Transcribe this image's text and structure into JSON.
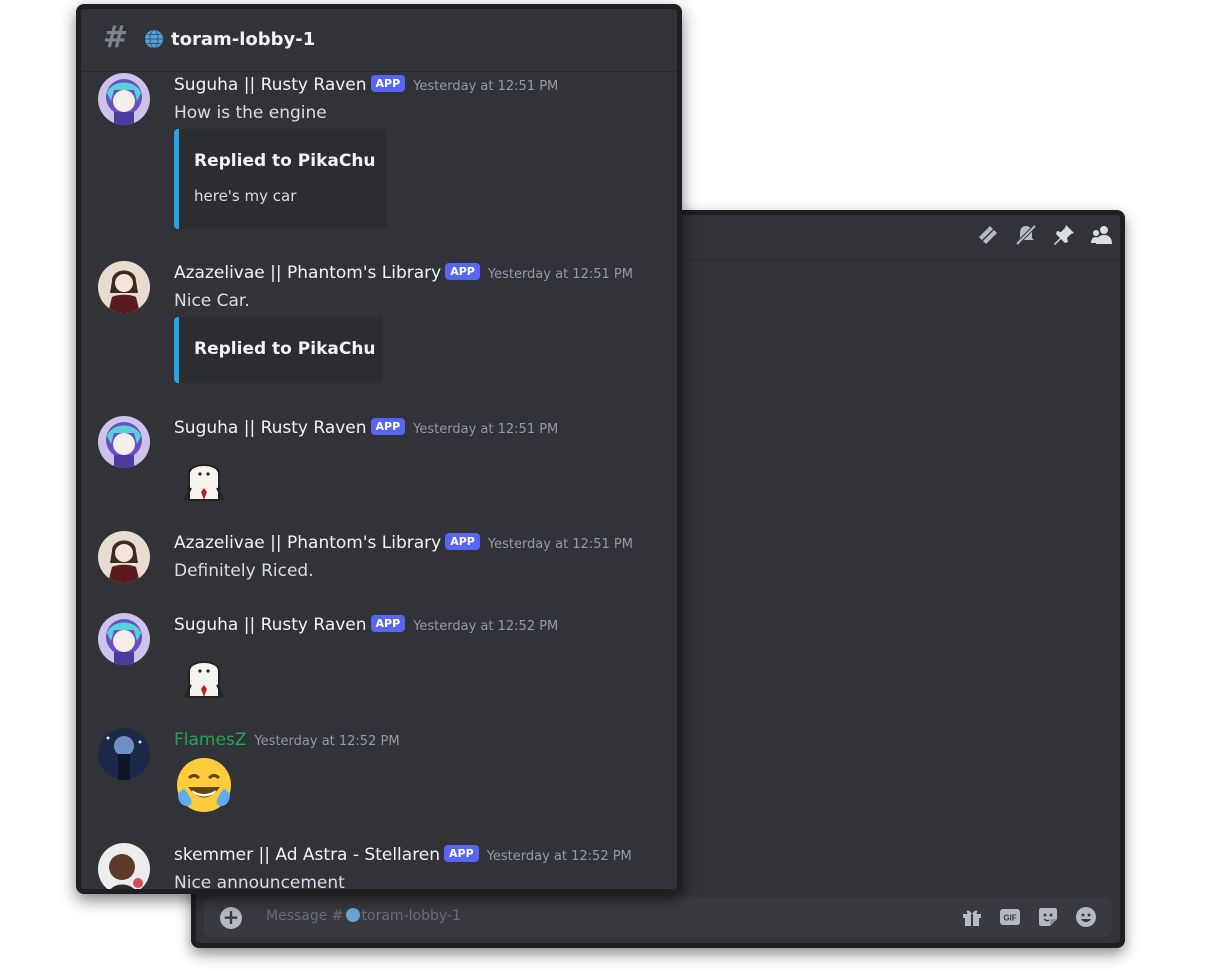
{
  "channel": {
    "name": "toram-lobby-1",
    "hash": "#"
  },
  "back_window": {
    "toolbar_icons": [
      "threads-icon",
      "muted-bell-icon",
      "pin-icon",
      "members-icon"
    ],
    "composer": {
      "placeholder_prefix": "Message #",
      "placeholder_channel": "toram-lobby-1",
      "icons": [
        "gift-icon",
        "gif-icon",
        "sticker-icon",
        "emoji-icon"
      ],
      "gif_label": "GIF"
    }
  },
  "app_badge": "APP",
  "messages": [
    {
      "user": "Suguha || Rusty Raven",
      "app": true,
      "time": "Yesterday at 12:51 PM",
      "text": "How is the engine",
      "reply_title": "Replied to PikaChu",
      "reply_text": "here's my car"
    },
    {
      "user": "Azazelivae || Phantom's Library",
      "app": true,
      "time": "Yesterday at 12:51 PM",
      "text": "Nice Car.",
      "reply_title": "Replied to PikaChu"
    },
    {
      "user": "Suguha || Rusty Raven",
      "app": true,
      "time": "Yesterday at 12:51 PM",
      "sticker": "white-character-sticker"
    },
    {
      "user": "Azazelivae || Phantom's Library",
      "app": true,
      "time": "Yesterday at 12:51 PM",
      "text": "Definitely Riced."
    },
    {
      "user": "Suguha || Rusty Raven",
      "app": true,
      "time": "Yesterday at 12:52 PM",
      "sticker": "white-character-sticker"
    },
    {
      "user": "FlamesZ",
      "app": false,
      "user_color": "#23a55a",
      "time": "Yesterday at 12:52 PM",
      "emoji": "tears-of-joy-emoji"
    },
    {
      "user": "skemmer || Ad Astra - Stellaren",
      "app": true,
      "time": "Yesterday at 12:52 PM",
      "text": "Nice announcement"
    }
  ],
  "colors": {
    "bg": "#313338",
    "frame": "#1e1f22",
    "accent": "#5865f2",
    "embed_bar": "#23a5e6"
  }
}
